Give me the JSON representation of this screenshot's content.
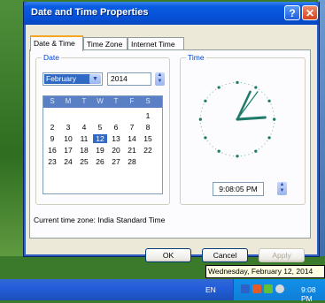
{
  "window": {
    "title": "Date and Time Properties",
    "help_label": "?",
    "close_label": "✕"
  },
  "tabs": [
    {
      "label": "Date & Time",
      "active": true
    },
    {
      "label": "Time Zone",
      "active": false
    },
    {
      "label": "Internet Time",
      "active": false
    }
  ],
  "date_group": {
    "legend": "Date",
    "month": "February",
    "year": "2014",
    "day_headers": [
      "S",
      "M",
      "T",
      "W",
      "T",
      "F",
      "S"
    ],
    "weeks": [
      [
        "",
        "",
        "",
        "",
        "",
        "",
        "1"
      ],
      [
        "2",
        "3",
        "4",
        "5",
        "6",
        "7",
        "8"
      ],
      [
        "9",
        "10",
        "11",
        "12",
        "13",
        "14",
        "15"
      ],
      [
        "16",
        "17",
        "18",
        "19",
        "20",
        "21",
        "22"
      ],
      [
        "23",
        "24",
        "25",
        "26",
        "27",
        "28",
        ""
      ]
    ],
    "selected_day": "12"
  },
  "time_group": {
    "legend": "Time",
    "time_value": "9:08:05 PM"
  },
  "current_time_zone": "Current time zone:  India Standard Time",
  "buttons": {
    "ok": "OK",
    "cancel": "Cancel",
    "apply": "Apply"
  },
  "tooltip": "Wednesday, February 12, 2014",
  "taskbar": {
    "language": "EN",
    "clock": "9:08 PM"
  },
  "colors": {
    "titlebar": "#0550d6",
    "selection": "#316ac5",
    "legend": "#0046d5",
    "clock_hand": "#1f7a6a"
  }
}
